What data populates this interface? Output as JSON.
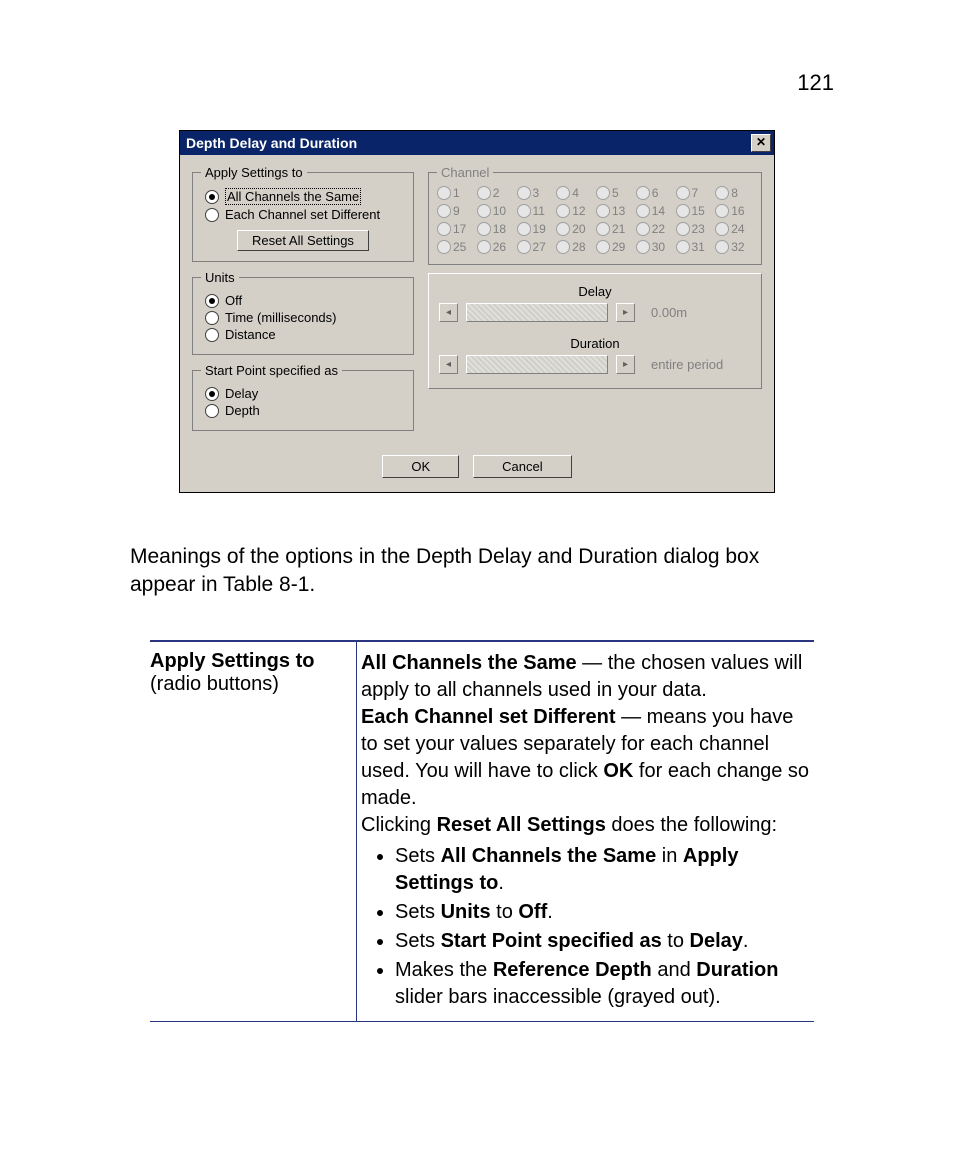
{
  "page_number": "121",
  "dialog": {
    "title": "Depth Delay and Duration",
    "apply": {
      "legend": "Apply Settings to",
      "options": [
        "All Channels the Same",
        "Each Channel set Different"
      ],
      "selected": 0,
      "reset_btn": "Reset All Settings"
    },
    "units": {
      "legend": "Units",
      "options": [
        "Off",
        "Time (milliseconds)",
        "Distance"
      ],
      "selected": 0
    },
    "startpoint": {
      "legend": "Start Point specified as",
      "options": [
        "Delay",
        "Depth"
      ],
      "selected": 0
    },
    "channels": {
      "legend": "Channel",
      "labels": [
        "1",
        "2",
        "3",
        "4",
        "5",
        "6",
        "7",
        "8",
        "9",
        "10",
        "11",
        "12",
        "13",
        "14",
        "15",
        "16",
        "17",
        "18",
        "19",
        "20",
        "21",
        "22",
        "23",
        "24",
        "25",
        "26",
        "27",
        "28",
        "29",
        "30",
        "31",
        "32"
      ]
    },
    "sliders": {
      "delay_label": "Delay",
      "delay_value": "0.00m",
      "duration_label": "Duration",
      "duration_value": "entire period"
    },
    "ok": "OK",
    "cancel": "Cancel"
  },
  "body_para": "Meanings of the options in the Depth Delay and Duration dialog box appear in Table 8-1.",
  "table": {
    "left_title": "Apply Settings to",
    "left_sub": "(radio buttons)",
    "r1a": "All Channels the Same",
    "r1b": " — the chosen values will apply to all channels used in your data.",
    "r2a": "Each Channel set Different",
    "r2b": " — means you have to set your values separately for each channel used. You will have to click ",
    "r2c": "OK",
    "r2d": " for each change so made.",
    "r3a": "Clicking ",
    "r3b": "Reset All Settings",
    "r3c": " does the following:",
    "b1a": "Sets ",
    "b1b": "All Channels the Same",
    "b1c": " in ",
    "b1d": "Apply Settings to",
    "b1e": ".",
    "b2a": "Sets ",
    "b2b": "Units",
    "b2c": " to ",
    "b2d": "Off",
    "b2e": ".",
    "b3a": "Sets ",
    "b3b": "Start Point specified as",
    "b3c": " to ",
    "b3d": "Delay",
    "b3e": ".",
    "b4a": "Makes the ",
    "b4b": "Reference Depth",
    "b4c": " and ",
    "b4d": "Duration",
    "b4e": " slider bars inaccessible (grayed out)."
  }
}
